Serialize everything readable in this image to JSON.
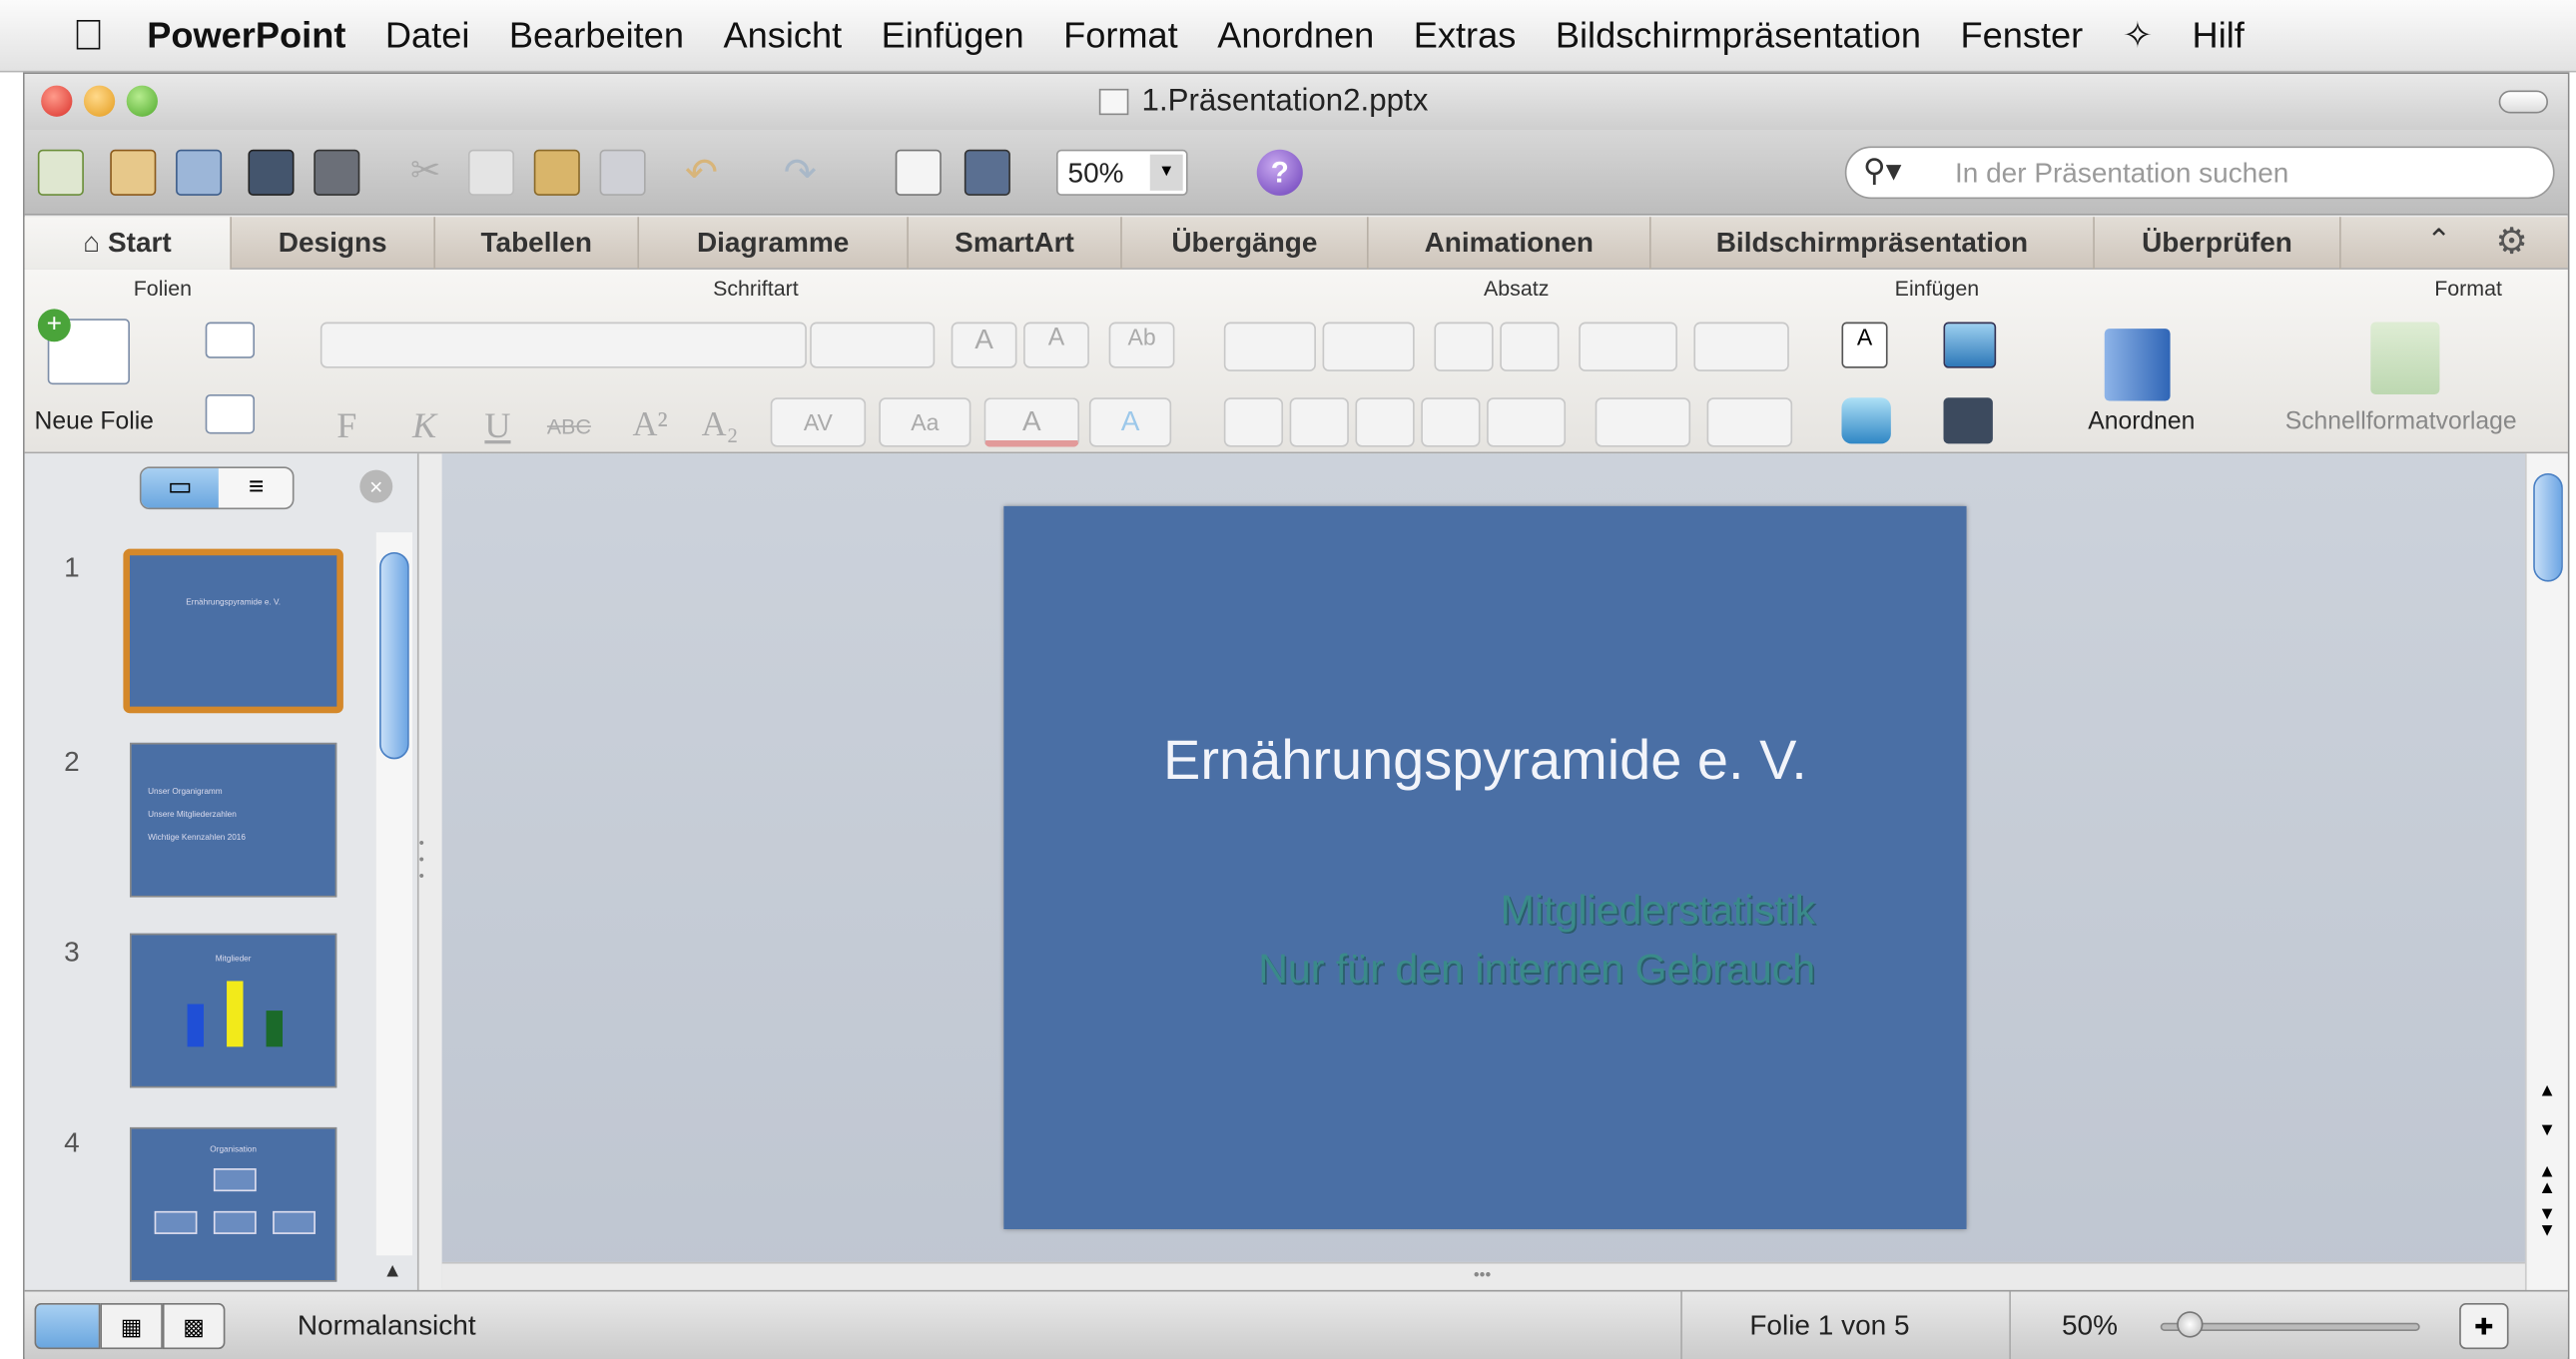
{
  "menubar": {
    "app": "PowerPoint",
    "items": [
      "Datei",
      "Bearbeiten",
      "Ansicht",
      "Einfügen",
      "Format",
      "Anordnen",
      "Extras",
      "Bildschirmpräsentation",
      "Fenster"
    ],
    "help": "Hilf"
  },
  "window": {
    "title": "1.Präsentation2.pptx"
  },
  "toolbar": {
    "zoom": "50%",
    "search_placeholder": "In der Präsentation suchen"
  },
  "tabs": [
    "Start",
    "Designs",
    "Tabellen",
    "Diagramme",
    "SmartArt",
    "Übergänge",
    "Animationen",
    "Bildschirmpräsentation",
    "Überprüfen"
  ],
  "ribbon": {
    "groups": {
      "folien": "Folien",
      "schriftart": "Schriftart",
      "absatz": "Absatz",
      "einfuegen": "Einfügen",
      "format": "Format"
    },
    "neue_folie": "Neue Folie",
    "anordnen": "Anordnen",
    "schnellformat": "Schnellformatvorlage",
    "font_buttons": [
      "F",
      "K",
      "U",
      "ABC",
      "A²",
      "A₂"
    ]
  },
  "slides": [
    {
      "num": "1",
      "text": "Ernährungspyramide e. V."
    },
    {
      "num": "2",
      "lines": [
        "Unser Organigramm",
        "Unsere Mitgliederzahlen",
        "Wichtige Kennzahlen 2016"
      ]
    },
    {
      "num": "3",
      "title": "Mitglieder"
    },
    {
      "num": "4",
      "title": "Organisation"
    }
  ],
  "slide": {
    "title": "Ernährungspyramide e. V.",
    "sub1": "Mitgliederstatistik",
    "sub2": "Nur für den internen Gebrauch"
  },
  "status": {
    "view": "Normalansicht",
    "slide": "Folie 1 von 5",
    "zoom": "50%"
  },
  "colors": {
    "slide_bg": "#4a6fa5",
    "subtitle": "#3a8a8a",
    "selection": "#d4882a"
  }
}
